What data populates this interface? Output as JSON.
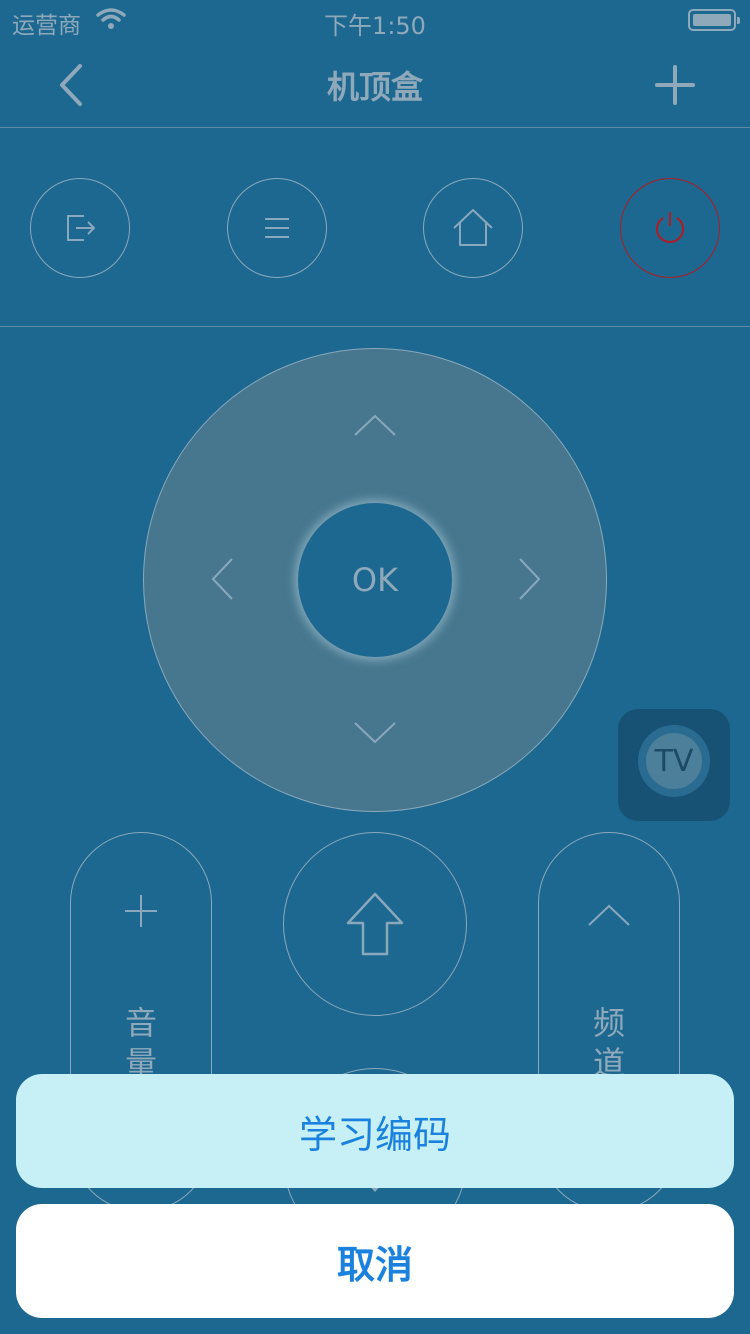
{
  "status_bar": {
    "carrier": "运营商",
    "time": "下午1:50"
  },
  "nav": {
    "title": "机顶盒",
    "back_icon": "chevron-left-icon",
    "add_icon": "plus-icon"
  },
  "top_buttons": [
    {
      "icon": "exit-icon"
    },
    {
      "icon": "menu-icon"
    },
    {
      "icon": "home-icon"
    },
    {
      "icon": "power-icon",
      "color": "#b01c22"
    }
  ],
  "dpad": {
    "ok_label": "OK"
  },
  "tv_button": {
    "label": "TV"
  },
  "volume": {
    "plus_icon": "plus-icon",
    "label_line1": "音",
    "label_line2": "量"
  },
  "channel": {
    "up_icon": "chevron-up-icon",
    "label_line1": "频",
    "label_line2": "道"
  },
  "action_sheet": {
    "learn_label": "学习编码",
    "cancel_label": "取消",
    "accent_color": "#1a82de"
  }
}
